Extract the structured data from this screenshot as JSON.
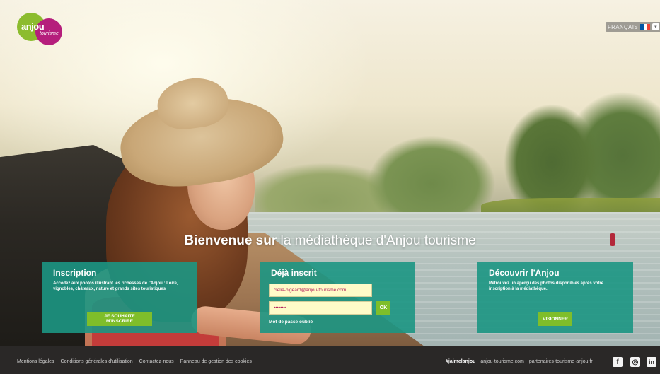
{
  "logo": {
    "word1": "anjou",
    "word2": "tourisme"
  },
  "language": {
    "selected": "FRANÇAIS",
    "flag_colors": [
      "#0055a4",
      "#ffffff",
      "#ef4135"
    ]
  },
  "welcome": {
    "bold": "Bienvenue sur",
    "light": "la médiathèque d'Anjou tourisme"
  },
  "panels": {
    "inscription": {
      "title": "Inscription",
      "description": "Accédez aux photos illustrant les richesses de l'Anjou : Loire, vignobles, châteaux, nature et grands sites touristiques",
      "button": "JE SOUHAITE M'INSCRIRE"
    },
    "login": {
      "title": "Déjà inscrit",
      "email_value": "clelia-bigeard@anjou-tourisme.com",
      "password_value": "••••••••",
      "ok_label": "OK",
      "forgot": "Mot de passe oublié"
    },
    "discover": {
      "title": "Découvrir l'Anjou",
      "description": "Retrouvez un aperçu des photos disponibles après votre inscription à la médiathèque.",
      "button": "VISIONNER"
    }
  },
  "footer": {
    "links": [
      "Mentions légales",
      "Conditions générales d'utilisation",
      "Contactez-nous",
      "Panneau de gestion des cookies"
    ],
    "hashtag": "#jaimelanjou",
    "site1": "anjou-tourisme.com",
    "site2": "partenaires-tourisme-anjou.fr",
    "social": {
      "facebook": "f",
      "instagram": "◎",
      "linkedin": "in"
    }
  },
  "colors": {
    "panel": "#1c9683",
    "button": "#7fbe2a",
    "footer": "#2a2827",
    "field": "#fffbc8"
  }
}
